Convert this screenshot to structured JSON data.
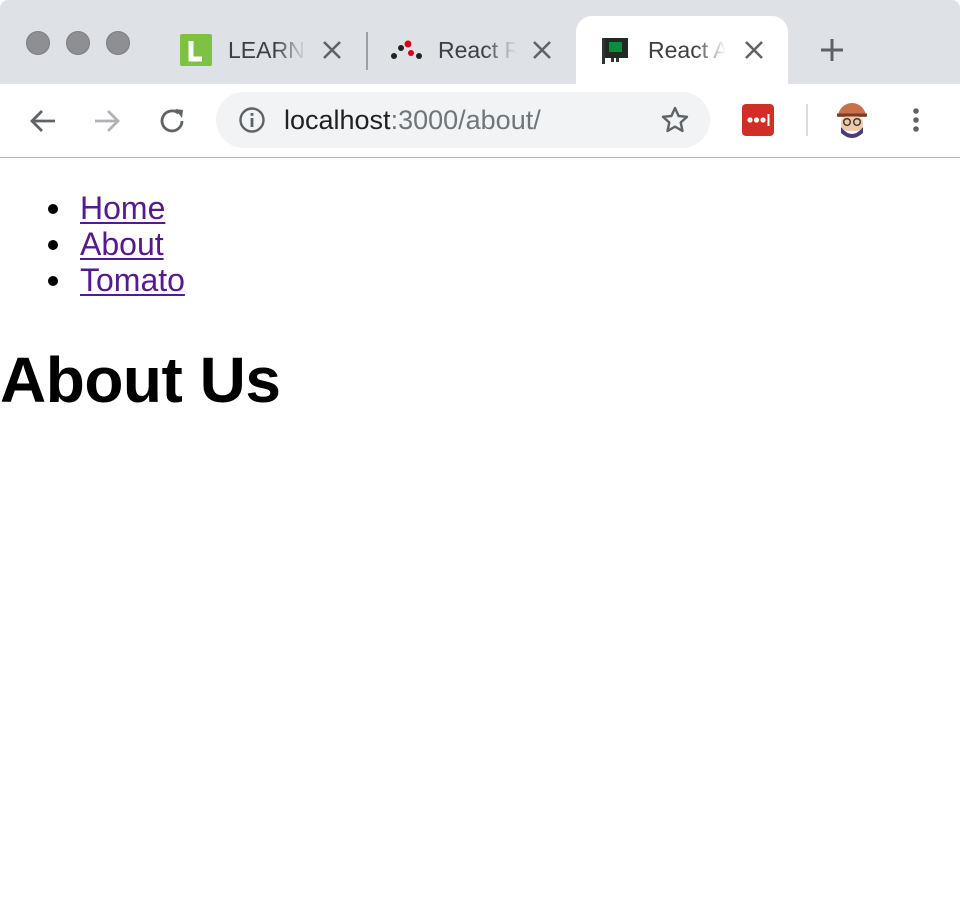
{
  "browser": {
    "tabs": [
      {
        "title": "LEARN",
        "favicon": "learn-l-icon",
        "active": false
      },
      {
        "title": "React R",
        "favicon": "react-router-icon",
        "active": false
      },
      {
        "title": "React A",
        "favicon": "circuit-board-icon",
        "active": true
      }
    ],
    "url": {
      "host": "localhost",
      "rest": ":3000/about/"
    },
    "colors": {
      "tabstrip": "#dee1e6",
      "lastpass": "#d32d27",
      "link": "#551a8b"
    }
  },
  "page": {
    "nav": [
      {
        "label": "Home"
      },
      {
        "label": "About"
      },
      {
        "label": "Tomato"
      }
    ],
    "heading": "About Us"
  }
}
